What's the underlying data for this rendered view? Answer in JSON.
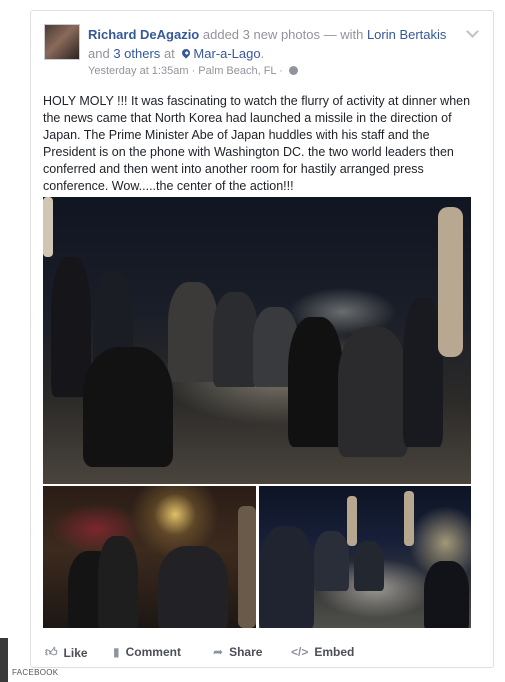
{
  "post": {
    "author": "Richard DeAgazio",
    "action_text": "added 3 new photos — with",
    "tagged_person": "Lorin Bertakis",
    "and_text": "and",
    "others_text": "3 others",
    "at_text": "at",
    "location": "Mar-a-Lago",
    "period": ".",
    "timestamp": "Yesterday at 1:35am",
    "place_separator": "·",
    "place": "Palm Beach, FL",
    "privacy_separator": "·",
    "body": "HOLY MOLY !!! It was fascinating to watch the flurry of activity at dinner when the news came that North Korea had launched a missile in the direction of Japan. The Prime Minister Abe of Japan huddles with his staff and the President is on the phone with Washington DC. the two world leaders then conferred and then went into another room for hastily arranged press conference. Wow.....the center of the action!!!"
  },
  "actions": {
    "like": "Like",
    "comment": "Comment",
    "share": "Share",
    "embed": "Embed"
  },
  "footer": {
    "label": "FACEBOOK"
  },
  "icons": {
    "location": "map-pin-icon",
    "privacy": "globe-icon",
    "menu": "chevron-down-icon",
    "like": "thumbs-up-icon",
    "comment": "speech-bubble-icon",
    "share": "share-arrow-icon",
    "embed": "code-icon"
  },
  "colors": {
    "link": "#365899",
    "meta": "#90949c",
    "text": "#1d2129"
  }
}
